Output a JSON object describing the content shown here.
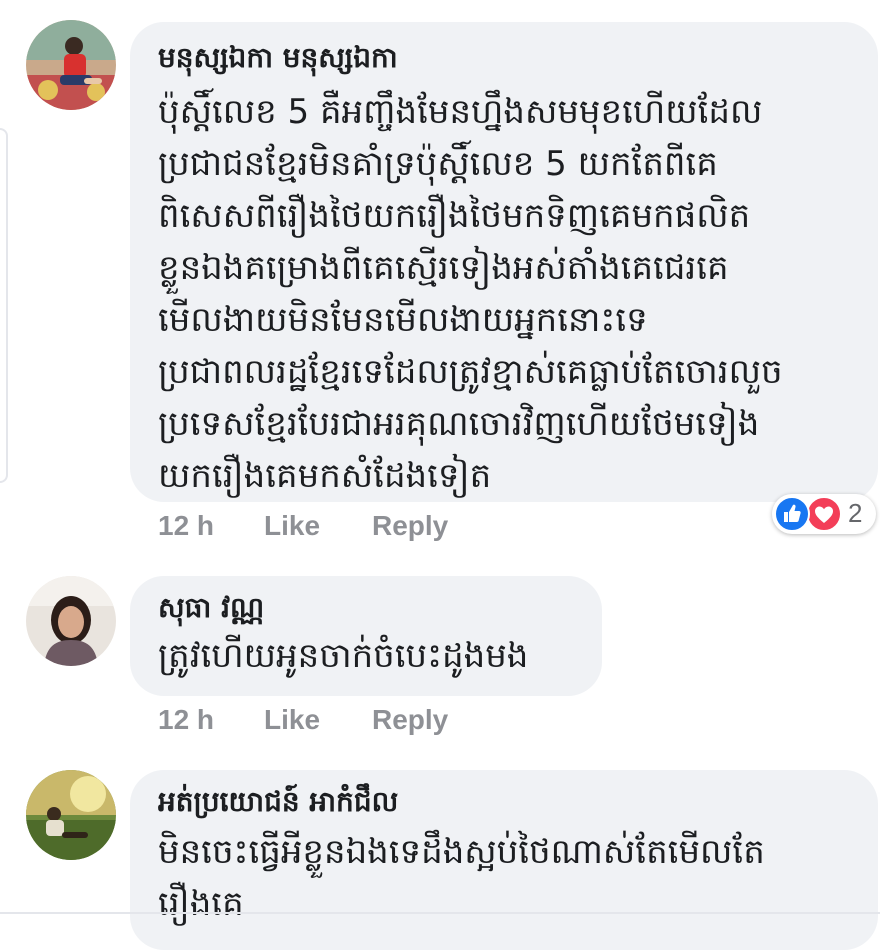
{
  "comments": [
    {
      "author": "មនុស្សឯកា មនុស្សឯកា",
      "lines": [
        "ប៉ុស្តិ៍លេខ 5 គឺអញ្ចឹងមែនហ្នឹងសមមុខហើយដែល",
        "ប្រជាជនខ្មែរមិនគាំទ្រប៉ុស្តិ៍លេខ 5 យកតែពីគេ",
        "ពិសេសពីរឿងថៃយករឿងថៃមកទិញគេមកផលិត",
        "ខ្លួនឯងគម្រោងពីគេស្មើរទៀងអស់តាំងគេជេរគេ",
        "មើលងាយមិនមែនមើលងាយអ្នកនោះទេ",
        "ប្រជាពលរដ្ឋខ្មែរទេដែលត្រូវខ្មាស់គេធ្លាប់តែចោរលួច",
        "ប្រទេសខ្មែរបែរជាអរគុណចោរវិញហើយថែមទៀង",
        "យករឿងគេមកសំដែងទៀត"
      ],
      "time": "12 h",
      "like_label": "Like",
      "reply_label": "Reply",
      "reactions": {
        "icons": [
          "like-icon",
          "love-icon"
        ],
        "count": "2"
      }
    },
    {
      "author": "សុធា វណ្ណ",
      "lines": [
        "ត្រូវហើយអូនចាក់ចំបេះដូងមង"
      ],
      "time": "12 h",
      "like_label": "Like",
      "reply_label": "Reply"
    },
    {
      "author": "អត់ប្រយោជន៍ អាកំជឹល",
      "lines": [
        "មិនចេះធ្វើអីខ្លួនឯងទេដឹងស្អប់ថៃណាស់តែមើលតែ",
        "រឿងគេ"
      ]
    }
  ],
  "colors": {
    "bubble": "#f0f2f5",
    "action_text": "#8e9095",
    "like_blue": "#1877f2",
    "love_red": "#f33e58"
  }
}
